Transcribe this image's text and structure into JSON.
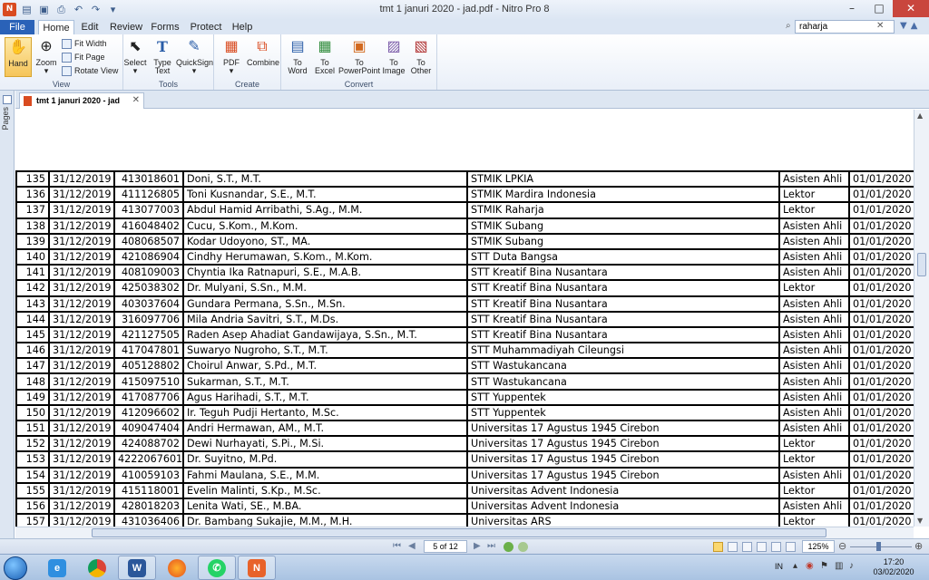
{
  "window": {
    "title": "tmt 1 januri 2020 - jad.pdf - Nitro Pro 8",
    "minimize": "–",
    "maximize": "□",
    "close": "✕"
  },
  "menu": {
    "file": "File",
    "tabs": [
      "Home",
      "Edit",
      "Review",
      "Forms",
      "Protect",
      "Help"
    ],
    "search_value": "raharja"
  },
  "ribbon": {
    "view": {
      "label": "View",
      "hand": "Hand",
      "zoom": "Zoom",
      "fit_width": "Fit Width",
      "fit_page": "Fit Page",
      "rotate_view": "Rotate View"
    },
    "tools": {
      "label": "Tools",
      "select": "Select",
      "type_text": [
        "Type",
        "Text"
      ],
      "quicksign": "QuickSign"
    },
    "create": {
      "label": "Create",
      "pdf": "PDF",
      "combine": "Combine"
    },
    "convert": {
      "label": "Convert",
      "to_word": [
        "To",
        "Word"
      ],
      "to_excel": [
        "To",
        "Excel"
      ],
      "to_powerpoint": [
        "To",
        "PowerPoint"
      ],
      "to_image": [
        "To",
        "Image"
      ],
      "to_other": [
        "To",
        "Other"
      ]
    }
  },
  "sidebar": {
    "pages": "Pages"
  },
  "doc_tab": {
    "name": "tmt 1 januri 2020 - jad"
  },
  "table_rows": [
    [
      "135",
      "31/12/2019",
      "413018601",
      "Doni, S.T., M.T.",
      "STMIK LPKIA",
      "Asisten Ahli",
      "01/01/2020"
    ],
    [
      "136",
      "31/12/2019",
      "411126805",
      "Toni Kusnandar, S.E., M.T.",
      "STMIK Mardira Indonesia",
      "Lektor",
      "01/01/2020"
    ],
    [
      "137",
      "31/12/2019",
      "413077003",
      "Abdul Hamid Arribathi, S.Ag., M.M.",
      "STMIK Raharja",
      "Lektor",
      "01/01/2020"
    ],
    [
      "138",
      "31/12/2019",
      "416048402",
      "Cucu, S.Kom., M.Kom.",
      "STMIK Subang",
      "Asisten Ahli",
      "01/01/2020"
    ],
    [
      "139",
      "31/12/2019",
      "408068507",
      "Kodar Udoyono, ST., MA.",
      "STMIK Subang",
      "Asisten Ahli",
      "01/01/2020"
    ],
    [
      "140",
      "31/12/2019",
      "421086904",
      "Cindhy Herumawan, S.Kom., M.Kom.",
      "STT Duta Bangsa",
      "Asisten Ahli",
      "01/01/2020"
    ],
    [
      "141",
      "31/12/2019",
      "408109003",
      "Chyntia Ika Ratnapuri, S.E., M.A.B.",
      "STT Kreatif Bina Nusantara",
      "Asisten Ahli",
      "01/01/2020"
    ],
    [
      "142",
      "31/12/2019",
      "425038302",
      "Dr. Mulyani, S.Sn., M.M.",
      "STT Kreatif Bina Nusantara",
      "Lektor",
      "01/01/2020"
    ],
    [
      "143",
      "31/12/2019",
      "403037604",
      "Gundara Permana, S.Sn., M.Sn.",
      "STT Kreatif Bina Nusantara",
      "Asisten Ahli",
      "01/01/2020"
    ],
    [
      "144",
      "31/12/2019",
      "316097706",
      "Mila Andria Savitri, S.T., M.Ds.",
      "STT Kreatif Bina Nusantara",
      "Asisten Ahli",
      "01/01/2020"
    ],
    [
      "145",
      "31/12/2019",
      "421127505",
      "Raden Asep Ahadiat Gandawijaya, S.Sn., M.T.",
      "STT Kreatif Bina Nusantara",
      "Asisten Ahli",
      "01/01/2020"
    ],
    [
      "146",
      "31/12/2019",
      "417047801",
      "Suwaryo Nugroho, S.T., M.T.",
      "STT Muhammadiyah Cileungsi",
      "Asisten Ahli",
      "01/01/2020"
    ],
    [
      "147",
      "31/12/2019",
      "405128802",
      "Choirul Anwar, S.Pd., M.T.",
      "STT Wastukancana",
      "Asisten Ahli",
      "01/01/2020"
    ],
    [
      "148",
      "31/12/2019",
      "415097510",
      "Sukarman, S.T., M.T.",
      "STT Wastukancana",
      "Asisten Ahli",
      "01/01/2020"
    ],
    [
      "149",
      "31/12/2019",
      "417087706",
      "Agus Harihadi, S.T., M.T.",
      "STT Yuppentek",
      "Asisten Ahli",
      "01/01/2020"
    ],
    [
      "150",
      "31/12/2019",
      "412096602",
      "Ir. Teguh Pudji Hertanto, M.Sc.",
      "STT Yuppentek",
      "Asisten Ahli",
      "01/01/2020"
    ],
    [
      "151",
      "31/12/2019",
      "409047404",
      "Andri Hermawan, AM., M.T.",
      "Universitas 17 Agustus 1945 Cirebon",
      "Asisten Ahli",
      "01/01/2020"
    ],
    [
      "152",
      "31/12/2019",
      "424088702",
      "Dewi Nurhayati, S.Pi., M.Si.",
      "Universitas 17 Agustus 1945 Cirebon",
      "Lektor",
      "01/01/2020"
    ],
    [
      "153",
      "31/12/2019",
      "4222067601",
      "Dr. Suyitno, M.Pd.",
      "Universitas 17 Agustus 1945 Cirebon",
      "Lektor",
      "01/01/2020"
    ],
    [
      "154",
      "31/12/2019",
      "410059103",
      "Fahmi Maulana, S.E., M.M.",
      "Universitas 17 Agustus 1945 Cirebon",
      "Asisten Ahli",
      "01/01/2020"
    ],
    [
      "155",
      "31/12/2019",
      "415118001",
      "Evelin Malinti, S.Kp., M.Sc.",
      "Universitas Advent Indonesia",
      "Lektor",
      "01/01/2020"
    ],
    [
      "156",
      "31/12/2019",
      "428018203",
      "Lenita Wati, SE., M.BA.",
      "Universitas Advent Indonesia",
      "Asisten Ahli",
      "01/01/2020"
    ],
    [
      "157",
      "31/12/2019",
      "431036406",
      "Dr. Bambang Sukajie, M.M., M.H.",
      "Universitas ARS",
      "Lektor",
      "01/01/2020"
    ]
  ],
  "status": {
    "page_indicator": "5 of 12",
    "zoom": "125%"
  },
  "taskbar": {
    "lang": "IN",
    "time": "17:20",
    "date": "03/02/2020"
  }
}
